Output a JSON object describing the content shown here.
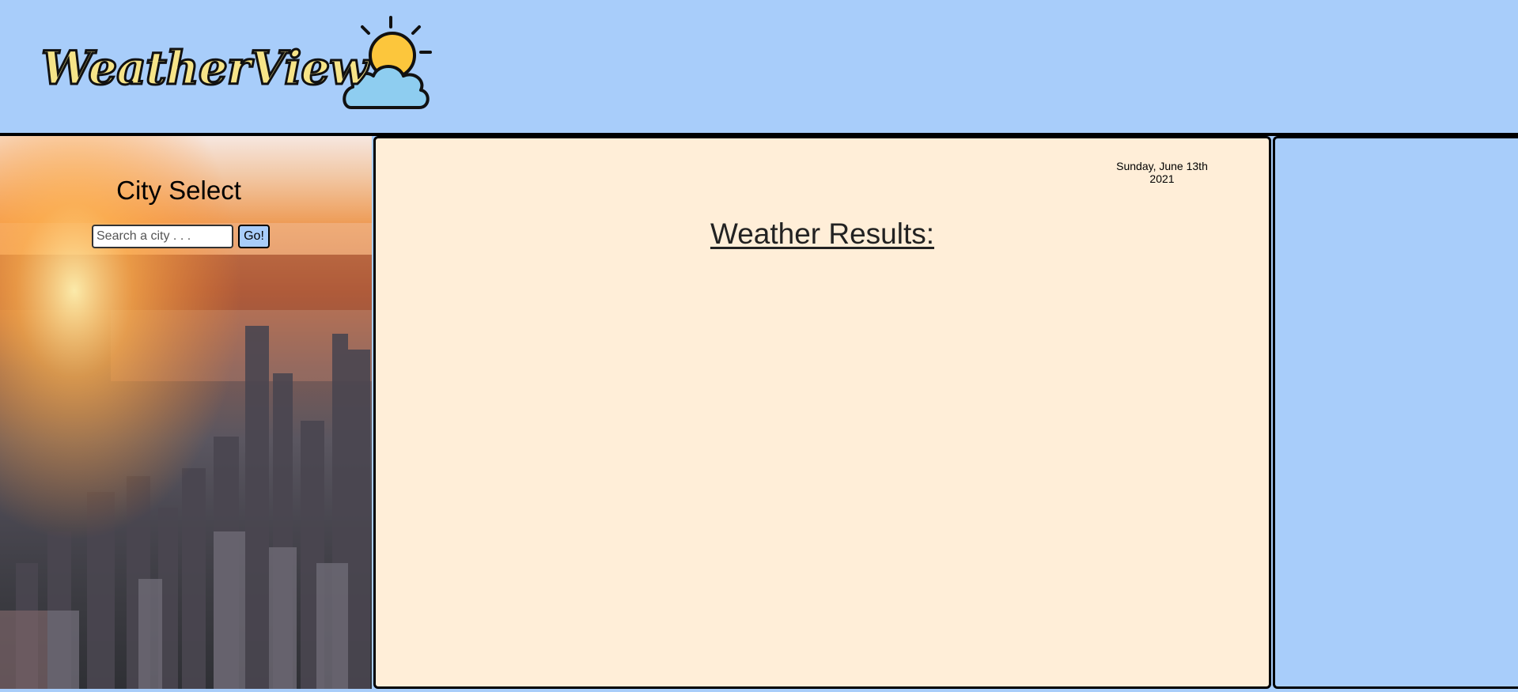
{
  "brand": {
    "name": "WeatherView",
    "logo_icon": "sun-cloud-icon"
  },
  "sidebar": {
    "title": "City Select",
    "search": {
      "placeholder": "Search a city . . .",
      "value": ""
    },
    "go_label": "Go!"
  },
  "main": {
    "date_line1": "Sunday, June 13th",
    "date_line2": "2021",
    "results_title": "Weather Results:"
  },
  "colors": {
    "header_bg": "#a8cdfa",
    "main_bg": "#ffeed8",
    "logo_fill": "#f6e488",
    "sun": "#fcc63c",
    "cloud": "#8ecdf0"
  }
}
